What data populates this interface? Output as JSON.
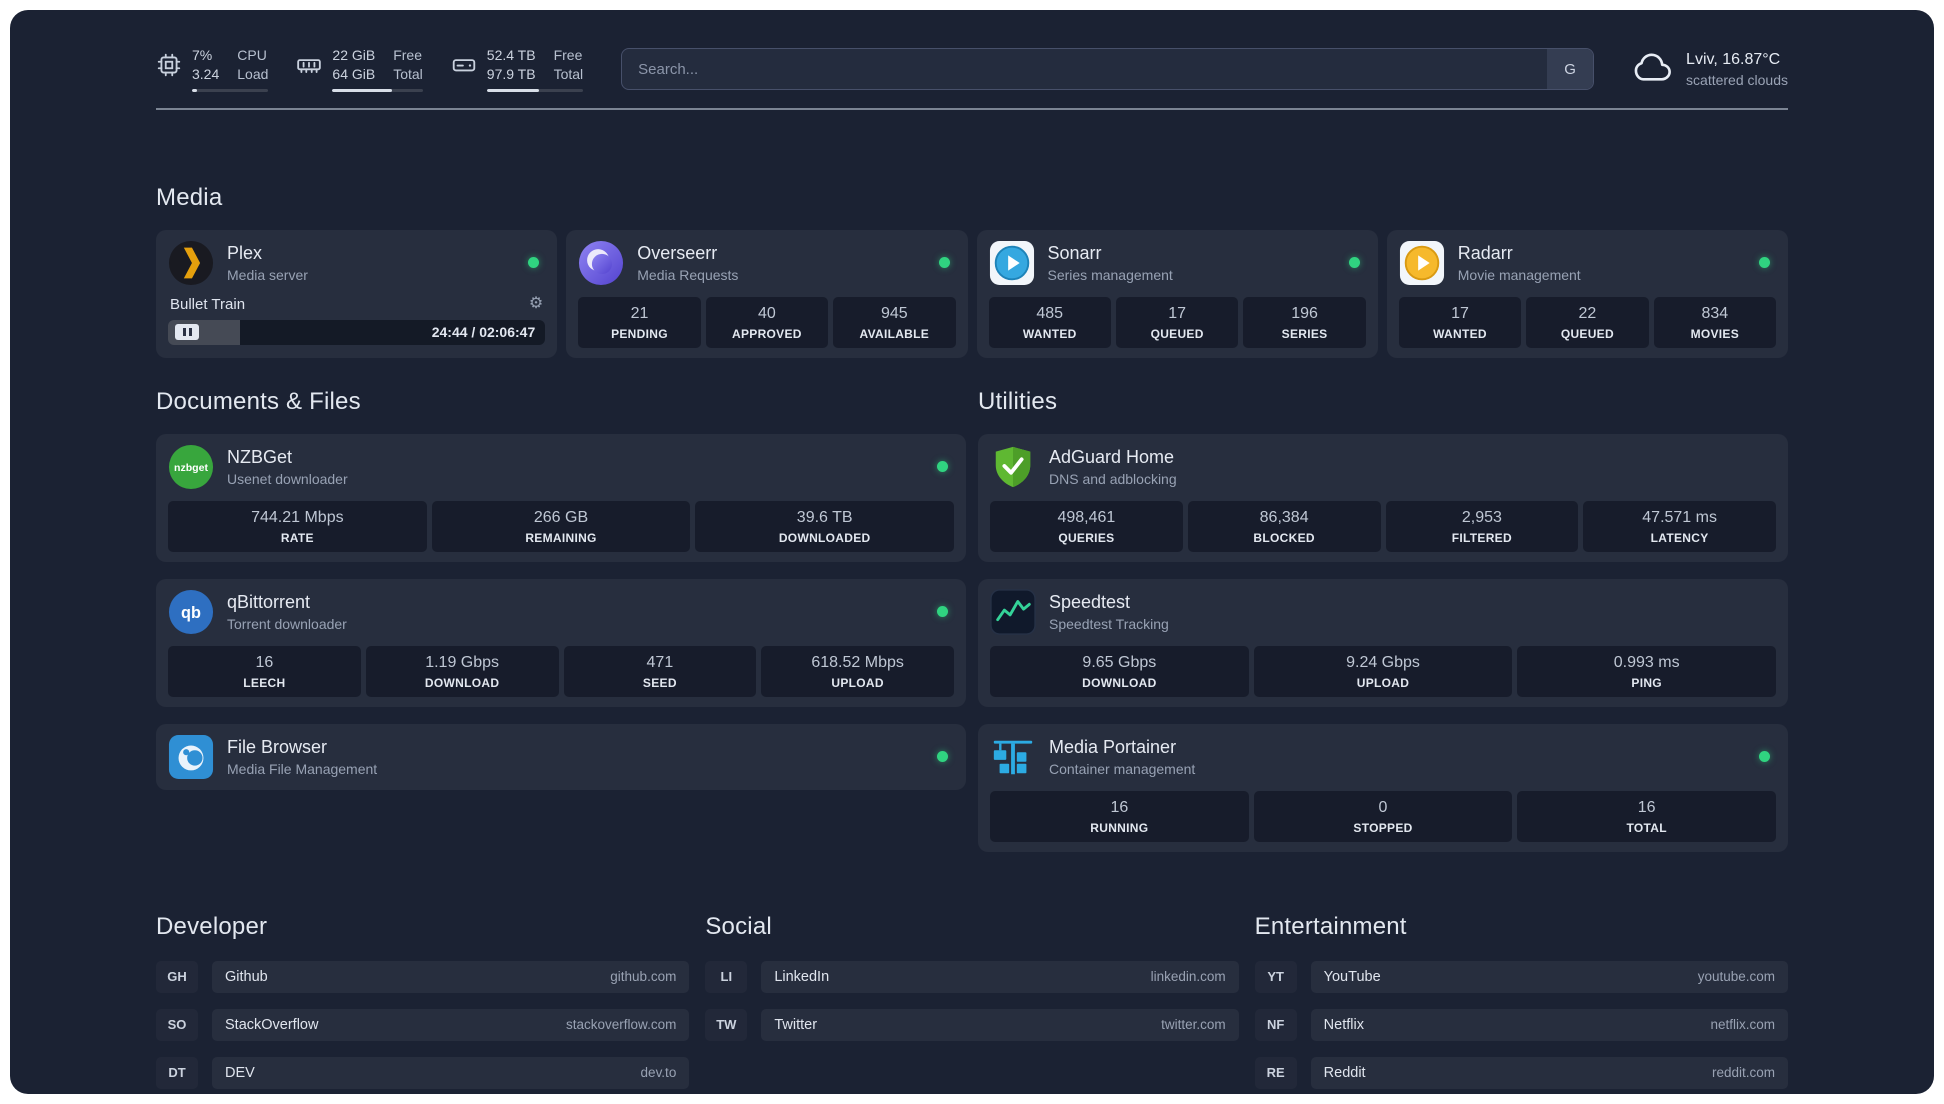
{
  "topbar": {
    "resources": [
      {
        "icon": "cpu-icon",
        "value_top": "7%",
        "value_bottom": "3.24",
        "label_top": "CPU",
        "label_bottom": "Load",
        "bar_percent": 7
      },
      {
        "icon": "memory-icon",
        "value_top": "22 GiB",
        "value_bottom": "64 GiB",
        "label_top": "Free",
        "label_bottom": "Total",
        "bar_percent": 66
      },
      {
        "icon": "disk-icon",
        "value_top": "52.4 TB",
        "value_bottom": "97.9 TB",
        "label_top": "Free",
        "label_bottom": "Total",
        "bar_percent": 54
      }
    ],
    "search": {
      "placeholder": "Search...",
      "provider_button": "G"
    },
    "weather": {
      "location": "Lviv, 16.87°C",
      "condition": "scattered clouds"
    }
  },
  "sections": {
    "media": {
      "title": "Media",
      "cards": {
        "plex": {
          "name": "Plex",
          "desc": "Media server",
          "online": true,
          "now_playing": {
            "title": "Bullet Train",
            "time": "24:44 / 02:06:47",
            "progress_percent": 19
          }
        },
        "overseerr": {
          "name": "Overseerr",
          "desc": "Media Requests",
          "online": true,
          "stats": [
            {
              "value": "21",
              "label": "PENDING"
            },
            {
              "value": "40",
              "label": "APPROVED"
            },
            {
              "value": "945",
              "label": "AVAILABLE"
            }
          ]
        },
        "sonarr": {
          "name": "Sonarr",
          "desc": "Series management",
          "online": true,
          "stats": [
            {
              "value": "485",
              "label": "WANTED"
            },
            {
              "value": "17",
              "label": "QUEUED"
            },
            {
              "value": "196",
              "label": "SERIES"
            }
          ]
        },
        "radarr": {
          "name": "Radarr",
          "desc": "Movie management",
          "online": true,
          "stats": [
            {
              "value": "17",
              "label": "WANTED"
            },
            {
              "value": "22",
              "label": "QUEUED"
            },
            {
              "value": "834",
              "label": "MOVIES"
            }
          ]
        }
      }
    },
    "documents": {
      "title": "Documents & Files",
      "cards": {
        "nzbget": {
          "name": "NZBGet",
          "desc": "Usenet downloader",
          "online": true,
          "stats": [
            {
              "value": "744.21 Mbps",
              "label": "RATE"
            },
            {
              "value": "266 GB",
              "label": "REMAINING"
            },
            {
              "value": "39.6 TB",
              "label": "DOWNLOADED"
            }
          ]
        },
        "qbittorrent": {
          "name": "qBittorrent",
          "desc": "Torrent downloader",
          "online": true,
          "stats": [
            {
              "value": "16",
              "label": "LEECH"
            },
            {
              "value": "1.19 Gbps",
              "label": "DOWNLOAD"
            },
            {
              "value": "471",
              "label": "SEED"
            },
            {
              "value": "618.52 Mbps",
              "label": "UPLOAD"
            }
          ]
        },
        "filebrowser": {
          "name": "File Browser",
          "desc": "Media File Management",
          "online": true
        }
      }
    },
    "utilities": {
      "title": "Utilities",
      "cards": {
        "adguard": {
          "name": "AdGuard Home",
          "desc": "DNS and adblocking",
          "stats": [
            {
              "value": "498,461",
              "label": "QUERIES"
            },
            {
              "value": "86,384",
              "label": "BLOCKED"
            },
            {
              "value": "2,953",
              "label": "FILTERED"
            },
            {
              "value": "47.571 ms",
              "label": "LATENCY"
            }
          ]
        },
        "speedtest": {
          "name": "Speedtest",
          "desc": "Speedtest Tracking",
          "stats": [
            {
              "value": "9.65 Gbps",
              "label": "DOWNLOAD"
            },
            {
              "value": "9.24 Gbps",
              "label": "UPLOAD"
            },
            {
              "value": "0.993 ms",
              "label": "PING"
            }
          ]
        },
        "portainer": {
          "name": "Media Portainer",
          "desc": "Container management",
          "online": true,
          "stats": [
            {
              "value": "16",
              "label": "RUNNING"
            },
            {
              "value": "0",
              "label": "STOPPED"
            },
            {
              "value": "16",
              "label": "TOTAL"
            }
          ]
        }
      }
    },
    "bookmarks": {
      "developer": {
        "title": "Developer",
        "items": [
          {
            "abbr": "GH",
            "name": "Github",
            "url": "github.com"
          },
          {
            "abbr": "SO",
            "name": "StackOverflow",
            "url": "stackoverflow.com"
          },
          {
            "abbr": "DT",
            "name": "DEV",
            "url": "dev.to"
          }
        ]
      },
      "social": {
        "title": "Social",
        "items": [
          {
            "abbr": "LI",
            "name": "LinkedIn",
            "url": "linkedin.com"
          },
          {
            "abbr": "TW",
            "name": "Twitter",
            "url": "twitter.com"
          }
        ]
      },
      "entertainment": {
        "title": "Entertainment",
        "items": [
          {
            "abbr": "YT",
            "name": "YouTube",
            "url": "youtube.com"
          },
          {
            "abbr": "NF",
            "name": "Netflix",
            "url": "netflix.com"
          },
          {
            "abbr": "RE",
            "name": "Reddit",
            "url": "reddit.com"
          }
        ]
      }
    }
  },
  "colors": {
    "page_background": "#1b2233",
    "card_background": "#262e42",
    "status_online": "#30d380",
    "plex_amber": "#e5a00d",
    "sonarr_blue": "#35a8e0",
    "radarr_yellow": "#f6b92c",
    "adguard_green": "#5fb832",
    "speedtest_green": "#34d399",
    "portainer_blue": "#2cabe3"
  }
}
